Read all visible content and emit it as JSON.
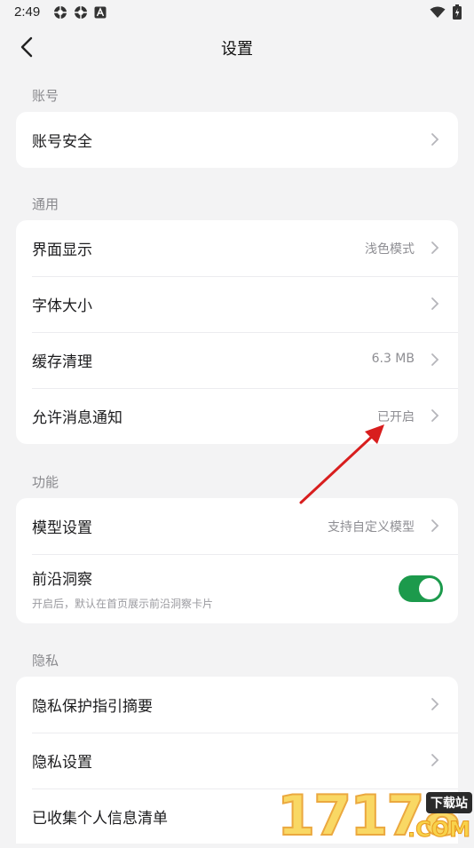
{
  "status": {
    "time": "2:49",
    "left_icons": [
      "settings-notif-icon",
      "settings-notif-icon",
      "a-notif-icon"
    ],
    "right_icons": [
      "wifi-icon",
      "battery-icon"
    ]
  },
  "header": {
    "title": "设置",
    "back_icon": "chevron-left-icon"
  },
  "sections": {
    "account": {
      "label": "账号",
      "items": [
        {
          "label": "账号安全",
          "value": ""
        }
      ]
    },
    "general": {
      "label": "通用",
      "items": [
        {
          "label": "界面显示",
          "value": "浅色模式"
        },
        {
          "label": "字体大小",
          "value": ""
        },
        {
          "label": "缓存清理",
          "value": "6.3 MB"
        },
        {
          "label": "允许消息通知",
          "value": "已开启"
        }
      ]
    },
    "features": {
      "label": "功能",
      "items": [
        {
          "label": "模型设置",
          "value": "支持自定义模型"
        },
        {
          "label": "前沿洞察",
          "sub": "开启后，默认在首页展示前沿洞察卡片",
          "toggle_on": true
        }
      ]
    },
    "privacy": {
      "label": "隐私",
      "items": [
        {
          "label": "隐私保护指引摘要",
          "value": ""
        },
        {
          "label": "隐私设置",
          "value": ""
        },
        {
          "label": "已收集个人信息清单",
          "value": ""
        }
      ]
    }
  },
  "watermark": {
    "digits": "17178",
    "badge": "下载站",
    "domain": ".COM"
  },
  "colors": {
    "accent": "#1c9a4c",
    "background": "#f3f3f4",
    "card": "#ffffff",
    "annotation": "#d81e1e"
  }
}
